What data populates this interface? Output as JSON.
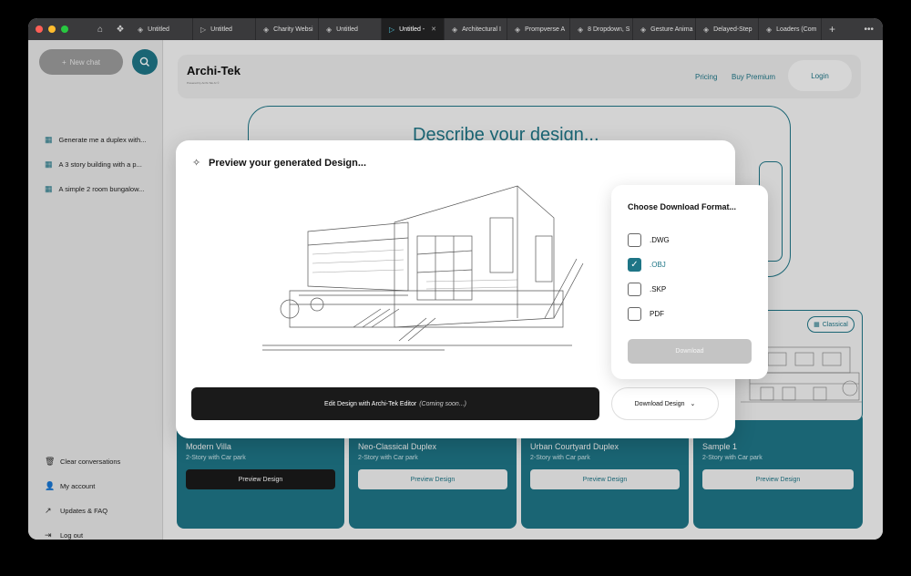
{
  "browser": {
    "tabs": [
      {
        "label": "Untitled",
        "active": false
      },
      {
        "label": "Untitled",
        "active": false
      },
      {
        "label": "Charity Websi",
        "active": false
      },
      {
        "label": "Untitled",
        "active": false
      },
      {
        "label": "Untitled -",
        "active": true
      },
      {
        "label": "Architectural I",
        "active": false
      },
      {
        "label": "Prompverse A",
        "active": false
      },
      {
        "label": "8 Dropdown, S",
        "active": false
      },
      {
        "label": "Gesture Anima",
        "active": false
      },
      {
        "label": "Delayed-Step",
        "active": false
      },
      {
        "label": "Loaders (Com",
        "active": false
      }
    ]
  },
  "sidebar": {
    "new_chat": "New chat",
    "history": [
      "Generate me a duplex with...",
      "A 3 story building with a p...",
      "A simple 2 room bungalow..."
    ],
    "footer": {
      "clear": "Clear conversations",
      "account": "My  account",
      "updates": "Updates & FAQ",
      "logout": "Log out"
    }
  },
  "header": {
    "brand": "Archi-Tek",
    "brand_sub": "Powered by Archi-Tek AI ©",
    "pricing": "Pricing",
    "buy_premium": "Buy Premium",
    "login": "Login"
  },
  "describe": {
    "title": "Describe your design..."
  },
  "cards": [
    {
      "title": "Modern Villa",
      "subtitle": "2-Story with Car park",
      "button": "Preview Design"
    },
    {
      "title": "Neo-Classical Duplex",
      "subtitle": "2-Story with Car park",
      "button": "Preview Design"
    },
    {
      "title": "Urban Courtyard Duplex",
      "subtitle": "2-Story with Car park",
      "button": "Preview Design"
    },
    {
      "title": "Sample 1",
      "subtitle": "2-Story with Car park",
      "button": "Preview Design"
    }
  ],
  "card_badge": "Classical",
  "modal": {
    "title": "Preview your generated Design...",
    "edit_button": "Edit Design with Archi-Tek Editor",
    "edit_note": "(Coming soon...)",
    "download_button": "Download Design"
  },
  "format_panel": {
    "title": "Choose Download Format...",
    "options": [
      {
        "label": ".DWG",
        "checked": false
      },
      {
        "label": ".OBJ",
        "checked": true
      },
      {
        "label": ".SKP",
        "checked": false
      },
      {
        "label": "PDF",
        "checked": false
      }
    ],
    "download": "Download"
  },
  "colors": {
    "accent": "#1e7586",
    "dark": "#1a1a1a"
  }
}
